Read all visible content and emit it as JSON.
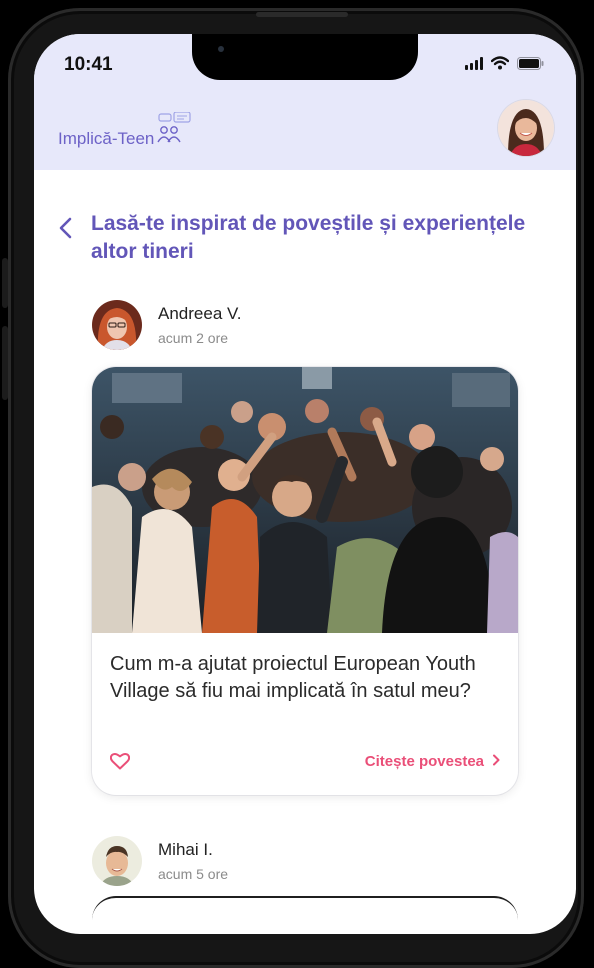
{
  "status_bar": {
    "time": "10:41"
  },
  "app": {
    "logo_text": "Implică-Teen"
  },
  "page": {
    "title": "Lasă-te inspirat de poveștile și experiențele altor tineri"
  },
  "posts": [
    {
      "author": "Andreea V.",
      "time": "acum 2 ore",
      "story_title": "Cum m-a ajutat proiectul European Youth Village să fiu mai implicată în satul meu?",
      "read_label": "Citește povestea"
    },
    {
      "author": "Mihai I.",
      "time": "acum 5 ore"
    }
  ],
  "icons": {
    "back": "chevron-left-icon",
    "like": "heart-icon",
    "read_more": "chevron-right-icon",
    "logo": "people-chat-icon"
  },
  "colors": {
    "header_bg": "#e7e8fa",
    "accent_purple": "#6256b8",
    "accent_pink": "#ea4f78"
  }
}
